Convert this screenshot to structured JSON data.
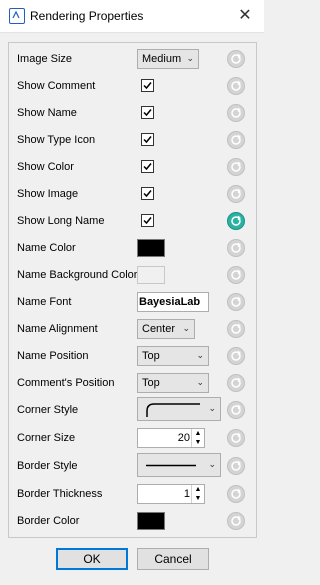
{
  "window": {
    "title": "Rendering Properties",
    "close": "✕"
  },
  "rows": {
    "image_size": {
      "label": "Image Size",
      "value": "Medium"
    },
    "show_comment": {
      "label": "Show Comment",
      "checked": true
    },
    "show_name": {
      "label": "Show Name",
      "checked": true
    },
    "show_type_icon": {
      "label": "Show Type Icon",
      "checked": true
    },
    "show_color": {
      "label": "Show Color",
      "checked": true
    },
    "show_image": {
      "label": "Show Image",
      "checked": true
    },
    "show_long_name": {
      "label": "Show Long Name",
      "checked": true
    },
    "name_color": {
      "label": "Name Color",
      "color": "#000000"
    },
    "name_background_color": {
      "label": "Name Background Color",
      "color": "#f0f0f0"
    },
    "name_font": {
      "label": "Name Font",
      "value": "BayesiaLab"
    },
    "name_alignment": {
      "label": "Name Alignment",
      "value": "Center"
    },
    "name_position": {
      "label": "Name Position",
      "value": "Top"
    },
    "comments_position": {
      "label": "Comment's Position",
      "value": "Top"
    },
    "corner_style": {
      "label": "Corner Style"
    },
    "corner_size": {
      "label": "Corner Size",
      "value": "20"
    },
    "border_style": {
      "label": "Border Style"
    },
    "border_thickness": {
      "label": "Border Thickness",
      "value": "1"
    },
    "border_color": {
      "label": "Border Color",
      "color": "#000000"
    }
  },
  "buttons": {
    "ok": "OK",
    "cancel": "Cancel"
  },
  "icons": {
    "reset": "reset-icon",
    "reset_active_color": "#2ab3a2",
    "chevron": "⌵"
  }
}
